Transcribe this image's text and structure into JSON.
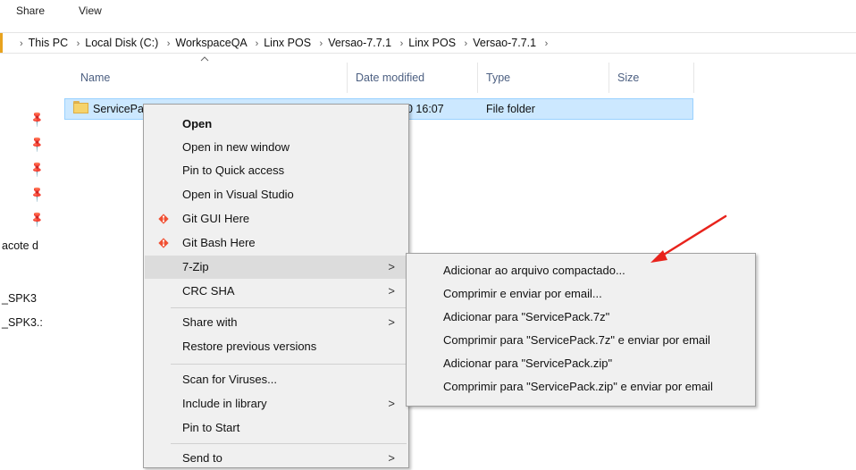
{
  "ribbon": {
    "tabs": [
      "Share",
      "View"
    ]
  },
  "address_bar": {
    "breadcrumbs": [
      "This PC",
      "Local Disk (C:)",
      "WorkspaceQA",
      "Linx POS",
      "Versao-7.7.1",
      "Linx POS",
      "Versao-7.7.1"
    ],
    "separator": "›"
  },
  "columns": {
    "name": "Name",
    "date_modified": "Date modified",
    "type": "Type",
    "size": "Size"
  },
  "file_row": {
    "name": "ServicePa",
    "date_fragment": "0 16:07",
    "type": "File folder"
  },
  "nav_pane": {
    "items": [
      "acote d",
      "_SPK3",
      "_SPK3.:"
    ]
  },
  "context_menu": {
    "open": "Open",
    "open_new_window": "Open in new window",
    "pin_quick_access": "Pin to Quick access",
    "open_visual_studio": "Open in Visual Studio",
    "git_gui": "Git GUI Here",
    "git_bash": "Git Bash Here",
    "seven_zip": "7-Zip",
    "crc_sha": "CRC SHA",
    "share_with": "Share with",
    "restore_versions": "Restore previous versions",
    "scan_viruses": "Scan for Viruses...",
    "include_library": "Include in library",
    "pin_start": "Pin to Start",
    "send_to": "Send to"
  },
  "submenu_7zip": {
    "items": [
      "Adicionar ao arquivo compactado...",
      "Comprimir e enviar por email...",
      "Adicionar para \"ServicePack.7z\"",
      "Comprimir para \"ServicePack.7z\" e enviar por email",
      "Adicionar para \"ServicePack.zip\"",
      "Comprimir para \"ServicePack.zip\" e enviar por email"
    ]
  },
  "icons": {
    "pin": "pin-icon",
    "folder": "folder-icon",
    "git": "git-icon",
    "submenu_arrow": "chevron-right-icon"
  },
  "colors": {
    "selection_bg": "#cce8ff",
    "selection_border": "#99d1ff",
    "menu_bg": "#f0f0f0",
    "menu_highlight": "#dcdcdc",
    "annotation_arrow": "#e8231c",
    "git_icon": "#f05033"
  }
}
